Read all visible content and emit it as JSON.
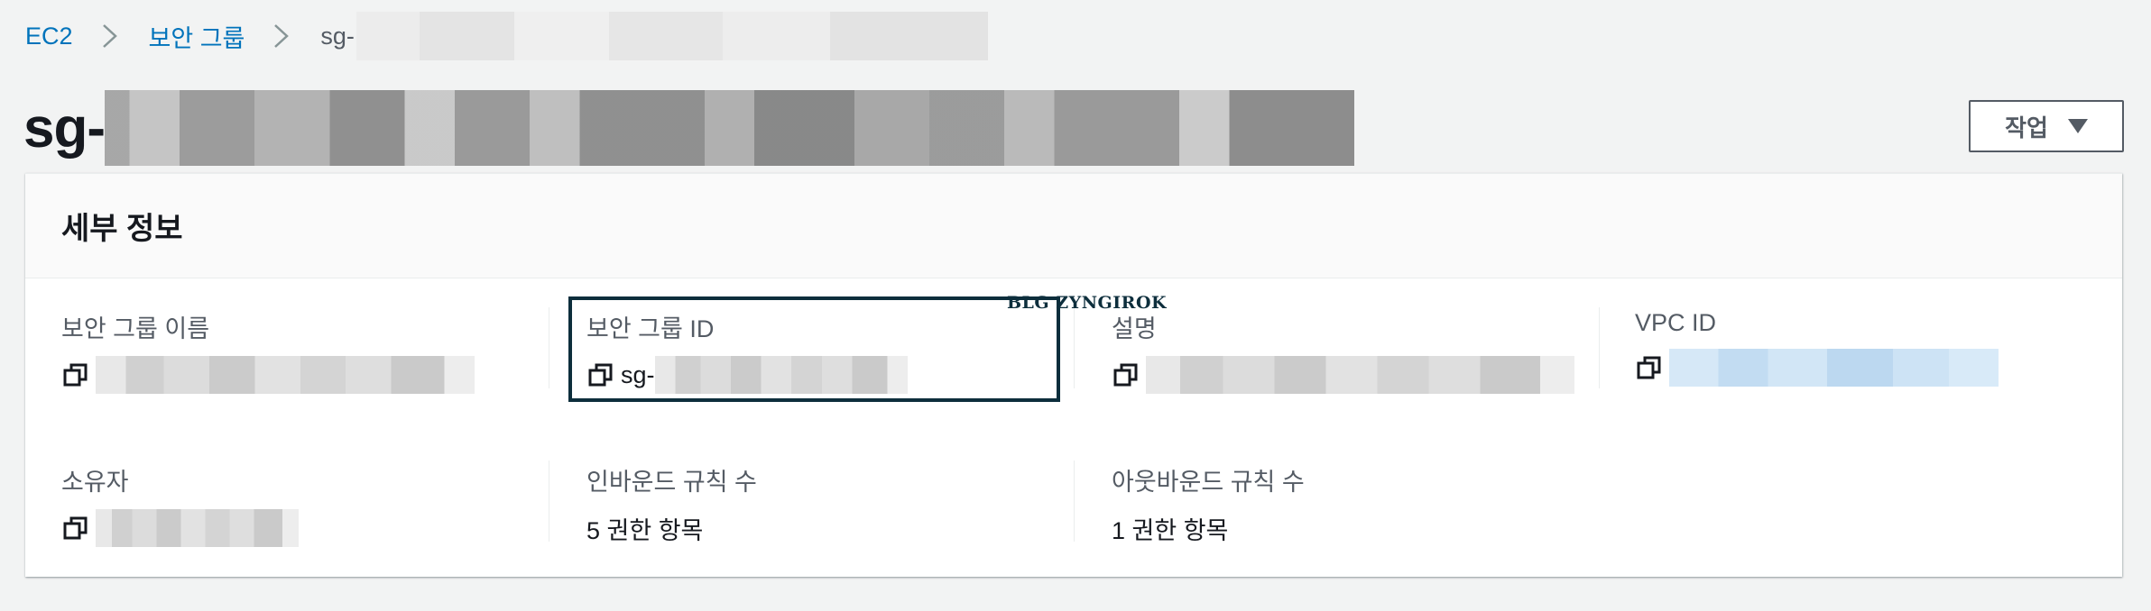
{
  "breadcrumb": {
    "items": [
      {
        "label": "EC2"
      },
      {
        "label": "보안 그룹"
      }
    ],
    "current_prefix": "sg-"
  },
  "header": {
    "title_prefix": "sg-",
    "actions_label": "작업"
  },
  "details": {
    "title": "세부 정보",
    "fields": {
      "sg_name": {
        "label": "보안 그룹 이름"
      },
      "sg_id": {
        "label": "보안 그룹 ID",
        "value_prefix": "sg-"
      },
      "description": {
        "label": "설명"
      },
      "vpc_id": {
        "label": "VPC ID"
      },
      "owner": {
        "label": "소유자"
      },
      "inbound": {
        "label": "인바운드 규칙 수",
        "value": "5 권한 항목"
      },
      "outbound": {
        "label": "아웃바운드 규칙 수",
        "value": "1 권한 항목"
      }
    }
  },
  "watermark": "BLG ZYNGIROK",
  "icons": [
    "chevron-right-icon",
    "copy-icon",
    "caret-down-icon"
  ],
  "colors": {
    "link": "#0073bb",
    "highlight": "#0d2e3c",
    "background": "#f2f3f3"
  }
}
